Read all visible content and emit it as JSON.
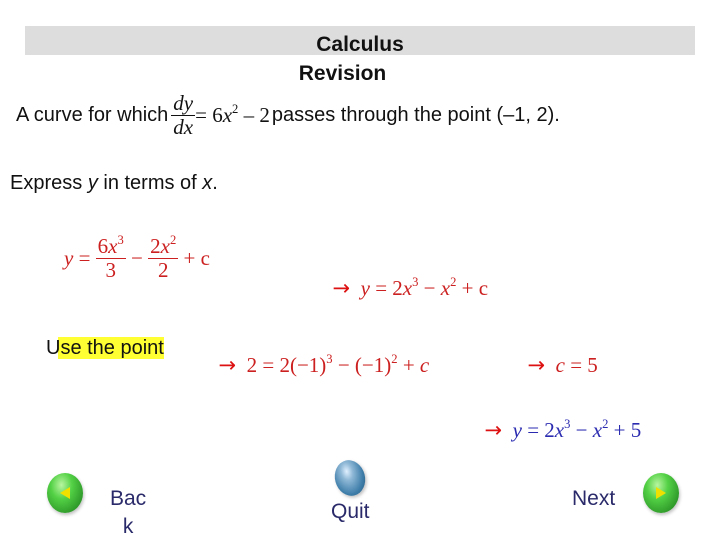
{
  "header": {
    "title_line1": "Calculus",
    "title_line2": "Revision"
  },
  "problem": {
    "intro": "A curve for which",
    "derivative_num": "dy",
    "derivative_den": "dx",
    "rhs_prefix": "= 6",
    "rhs_var": "x",
    "rhs_exp": "2",
    "rhs_suffix": " – 2",
    "condition": "passes through the point (–1, 2).",
    "task_prefix": "Express ",
    "task_y": "y",
    "task_mid": " in terms of ",
    "task_x": "x",
    "task_end": "."
  },
  "step1": {
    "y": "y",
    "eq": " = ",
    "frac1_num_coef": "6",
    "frac1_num_var": "x",
    "frac1_num_exp": "3",
    "frac1_den": "3",
    "minus": " − ",
    "frac2_num_coef": "2",
    "frac2_num_var": "x",
    "frac2_num_exp": "2",
    "frac2_den": "2",
    "plus_c": " + c"
  },
  "step2": {
    "arrow": "→",
    "text_y": "y",
    "text_eq": " = 2",
    "x1": "x",
    "e1": "3",
    "mid": " − ",
    "x2": "x",
    "e2": "2",
    "end": " + c"
  },
  "step3": {
    "label": "Use the point",
    "arrow": "→",
    "lhs": "2 = 2(−1)",
    "e1": "3",
    "mid": " − (−1)",
    "e2": "2",
    "end": " + ",
    "c": "c"
  },
  "step4": {
    "arrow": "→",
    "c": "c",
    "rest": " = 5"
  },
  "result": {
    "arrow": "→",
    "y": "y",
    "eq": " = 2",
    "x1": "x",
    "e1": "3",
    "mid": " − ",
    "x2": "x",
    "e2": "2",
    "end": " + 5"
  },
  "nav": {
    "back_label_line1": "Bac",
    "back_label_line2": "k",
    "quit_label": "Quit",
    "next_label": "Next",
    "back_icon": "green-orb-left-arrow",
    "quit_icon": "blue-orb",
    "next_icon": "green-orb-right-arrow",
    "arrow_color": "#f0e000"
  }
}
